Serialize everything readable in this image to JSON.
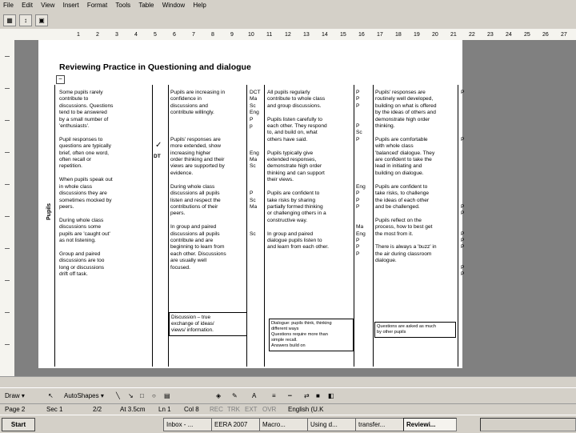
{
  "menu": [
    "File",
    "Edit",
    "View",
    "Insert",
    "Format",
    "Tools",
    "Table",
    "Window",
    "Help"
  ],
  "ruler": [
    "1",
    "2",
    "3",
    "4",
    "5",
    "6",
    "7",
    "8",
    "9",
    "10",
    "11",
    "12",
    "13",
    "14",
    "15",
    "16",
    "17",
    "18",
    "19",
    "20",
    "21",
    "22",
    "23",
    "24",
    "25",
    "26",
    "27"
  ],
  "document": {
    "title": "Reviewing Practice in Questioning and dialogue",
    "pupils_label": "Pupils",
    "col1": "Some pupils rarely\ncontribute to\ndiscussions. Questions\ntend to be answered\nby a small number of\n'enthusiasts'.\n\nPupil responses to\nquestions are typically\nbrief, often one word,\noften recall or\nrepetition.\n\nWhen pupils speak out\nin whole class\ndiscussions they are\nsometimes mocked by\npeers.\n\nDuring whole class\ndiscussions some\npupils are 'caught out'\nas not listening.\n\nGroup and paired\ndiscussions are too\nlong or discussions\ndrift off task.",
    "col2_tick": "✓",
    "col2_label": "DT",
    "col3": "Pupils are increasing in\nconfidence in\ndiscussions and\ncontribute willingly.\n\n\n\nPupils' responses are\nmore extended, show\nincreasing higher\norder thinking and their\nviews are supported by\nevidence.\n\nDuring whole class\ndiscussions all pupils\nlisten and respect the\ncontributions of their\npeers.\n\nIn group and paired\ndiscussions all pupils\ncontribute and are\nbeginning to learn from\neach other. Discussions\nare usually well\nfocused.",
    "col3_box": "Discussion – true\nexchange of ideas/\nviews/ information.",
    "col4": "DCT\nMa\nSc\nEng\nP\np\n\n\n\nEng\nMa\nSc\n\n\n\nP\nSc\nMa\n\n\n\nSc",
    "col5": "All pupils regularly\ncontribute to whole class\nand group discussions.\n\nPupils listen carefully to\neach other. They respond\nto, and build on, what\nothers have said.\n\nPupils typically give\nextended responses,\ndemonstrate high order\nthinking and can support\ntheir views.\n\nPupils are confident to\ntake risks by sharing\npartially formed thinking\nor challenging others in a\nconstructive way.\n\nIn group and paired\ndialogue pupils listen to\nand learn from each other.",
    "col5_box": "Dialogue: pupils think, thinking\ndifferent ways\nQuestions require more than\nsimple recall.\nAnswers build on",
    "col6": "P\nP\nP\n\n\nP\nSc\nP\n\n\n\n\n\n\nEng\nP\nP\nP\n\n\nMa\nEng\nP\nP\nP",
    "col7": "Pupils' responses are\nroutinely well developed,\nbuilding on what is offered\nby the ideas of others and\ndemonstrate high order\nthinking.\n\nPupils are comfortable\nwith whole class\n'balanced' dialogue. They\nare confident to take the\nlead in initiating and\nbuilding on dialogue.\n\nPupils are confident to\ntake risks, to challenge\nthe ideas of each other\nand be challenged.\n\nPupils reflect on the\nprocess, how to best get\nthe most from it.\n\nThere is always a 'buzz' in\nthe air during classroom\ndialogue.",
    "col7_box": "Questions are asked as much\nby other pupils",
    "col8": "P\n\n\n\n\n\n\nP\n\n\n\n\n\n\n\n\n\nP\nP\n\n\nP\nP\nP\n\n\nP\nP"
  },
  "drawbar": {
    "draw": "Draw ▾",
    "autoshapes": "AutoShapes ▾"
  },
  "status": {
    "page": "Page 2",
    "sec": "Sec 1",
    "pages": "2/2",
    "at": "At 3.5cm",
    "ln": "Ln 1",
    "col": "Col 8",
    "modes": [
      "REC",
      "TRK",
      "EXT",
      "OVR"
    ],
    "language": "English (U.K"
  },
  "taskbar": {
    "start": "Start",
    "tasks": [
      "Inbox - ...",
      "EERA 2007",
      "Macro...",
      "Using d...",
      "transfer...",
      "Reviewi..."
    ]
  }
}
